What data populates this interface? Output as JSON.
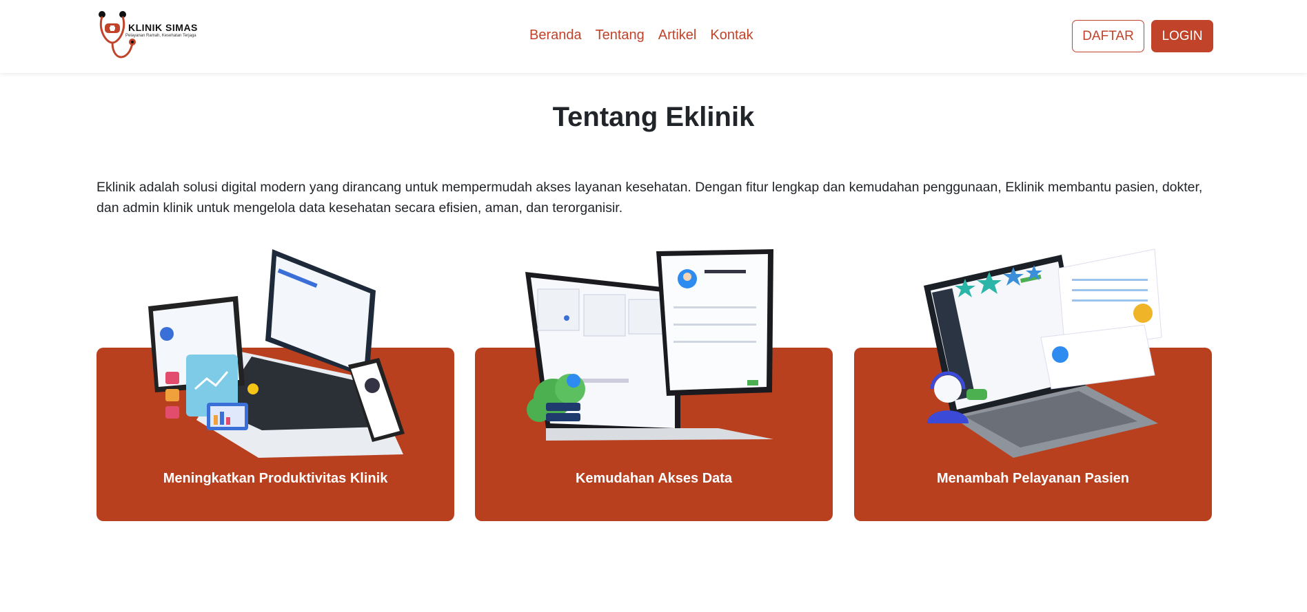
{
  "navbar": {
    "brand_name": "KLINIK SIMAS",
    "brand_tagline": "Pelayanan Ramah, Kesehatan Terjaga",
    "links": [
      "Beranda",
      "Tentang",
      "Artikel",
      "Kontak"
    ],
    "register_label": "DAFTAR",
    "login_label": "LOGIN"
  },
  "main": {
    "title": "Tentang Eklinik",
    "intro": "Eklinik adalah solusi digital modern yang dirancang untuk mempermudah akses layanan kesehatan. Dengan fitur lengkap dan kemudahan penggunaan, Eklinik membantu pasien, dokter, dan admin klinik untuk mengelola data kesehatan secara efisien, aman, dan terorganisir.",
    "features": [
      {
        "title": "Meningkatkan Produktivitas Klinik",
        "icon": "devices-illustration"
      },
      {
        "title": "Kemudahan Akses Data",
        "icon": "tablet-laptop-illustration"
      },
      {
        "title": "Menambah Pelayanan Pasien",
        "icon": "laptop-support-illustration"
      }
    ]
  },
  "colors": {
    "accent": "#c0432a",
    "card": "#b9401f",
    "text": "#212529"
  }
}
